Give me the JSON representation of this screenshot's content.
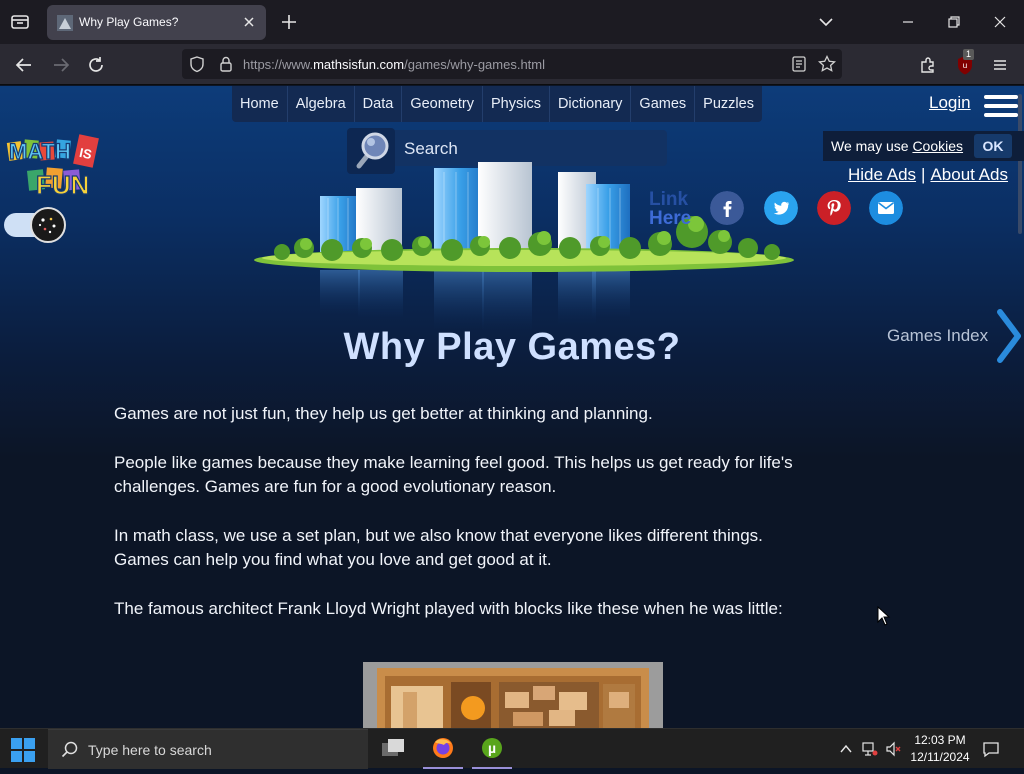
{
  "browser": {
    "tab": {
      "title": "Why Play Games?"
    },
    "url": {
      "prefix": "https://www.",
      "domain": "mathsisfun.com",
      "path": "/games/why-games.html"
    },
    "extension_badge": "1"
  },
  "site": {
    "nav": [
      "Home",
      "Algebra",
      "Data",
      "Geometry",
      "Physics",
      "Dictionary",
      "Games",
      "Puzzles"
    ],
    "login": "Login",
    "logo_text": [
      "MATH",
      "IS",
      "FUN"
    ],
    "search_label": "Search",
    "cookie": {
      "text": "We may use",
      "link": "Cookies",
      "ok": "OK"
    },
    "ads": {
      "hide": "Hide Ads",
      "separator": "|",
      "about": "About Ads"
    },
    "link_here": [
      "Link",
      "Here"
    ],
    "social": [
      {
        "name": "facebook",
        "color": "#3b5998",
        "glyph": "f"
      },
      {
        "name": "twitter",
        "color": "#2aa3ef",
        "glyph": "t"
      },
      {
        "name": "pinterest",
        "color": "#cb2027",
        "glyph": "p"
      },
      {
        "name": "email",
        "color": "#1d8de0",
        "glyph": "@"
      }
    ],
    "games_index": "Games Index",
    "page_title": "Why Play Games?",
    "paragraphs": [
      "Games are not just fun, they help us get better at thinking and planning.",
      "People like games because they make learning feel good. This helps us get ready for life's challenges. Games are fun for a good evolutionary reason.",
      "In math class, we use a set plan, but we also know that everyone likes different things. Games can help you find what you love and get good at it.",
      "The famous architect Frank Lloyd Wright played with blocks like these when he was little:"
    ]
  },
  "taskbar": {
    "search_placeholder": "Type here to search",
    "time": "12:03 PM",
    "date": "12/11/2024"
  }
}
